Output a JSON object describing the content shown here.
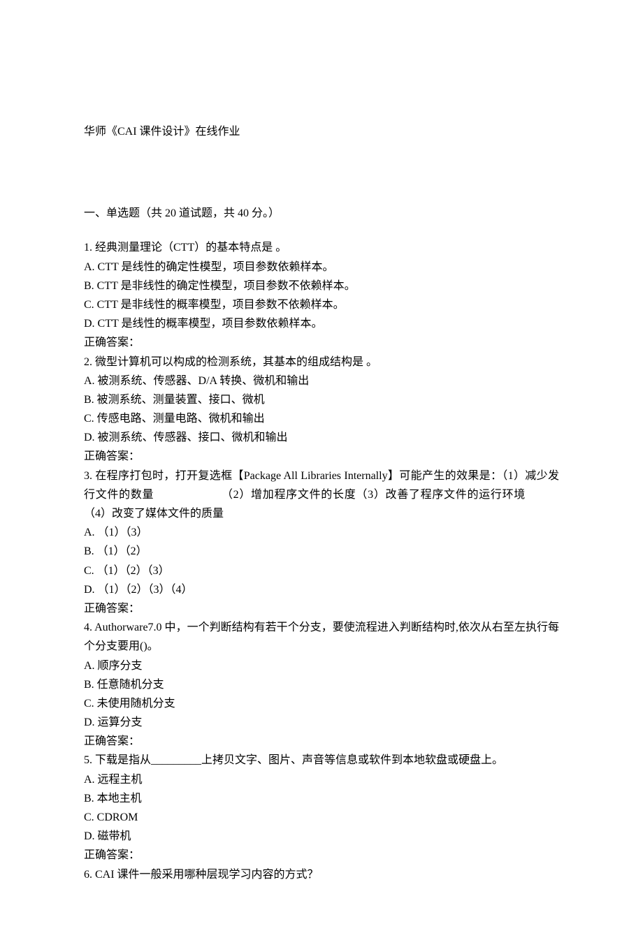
{
  "title": "华师《CAI 课件设计》在线作业",
  "section": {
    "heading": "一、单选题（共 20 道试题，共 40 分。）"
  },
  "questions": [
    {
      "stem": "1.   经典测量理论（CTT）的基本特点是 。",
      "options": [
        "A. CTT 是线性的确定性模型，项目参数依赖样本。",
        "B. CTT 是非线性的确定性模型，项目参数不依赖样本。",
        "C. CTT 是非线性的概率模型，项目参数不依赖样本。",
        "D. CTT 是线性的概率模型，项目参数依赖样本。"
      ],
      "answer": "正确答案："
    },
    {
      "stem": "2.   微型计算机可以构成的检测系统，其基本的组成结构是 。",
      "options": [
        "A. 被测系统、传感器、D/A 转换、微机和输出",
        "B. 被测系统、测量装置、接口、微机",
        "C. 传感电路、测量电路、微机和输出",
        "D. 被测系统、传感器、接口、微机和输出"
      ],
      "answer": "正确答案："
    },
    {
      "stem": "3.   在程序打包时，打开复选框【Package All Libraries Internally】可能产生的效果是：（1）减少发行文件的数量      （2）增加程序文件的长度（3）改善了程序文件的运行环境   （4）改变了媒体文件的质量",
      "options": [
        "A. （1）（3）",
        "B. （1）（2）",
        "C. （1）（2）（3）",
        "D. （1）（2）（3）（4）"
      ],
      "answer": "正确答案："
    },
    {
      "stem": "4.   Authorware7.0 中，一个判断结构有若干个分支，要使流程进入判断结构时,依次从右至左执行每个分支要用()。",
      "options": [
        "A. 顺序分支",
        "B. 任意随机分支",
        "C. 未使用随机分支",
        "D. 运算分支"
      ],
      "answer": "正确答案："
    },
    {
      "stem": "5.   下载是指从_________上拷贝文字、图片、声音等信息或软件到本地软盘或硬盘上。",
      "options": [
        "A. 远程主机",
        "B. 本地主机",
        "C. CDROM",
        "D. 磁带机"
      ],
      "answer": "正确答案："
    },
    {
      "stem": "6.   CAI 课件一般采用哪种层现学习内容的方式？",
      "options": [],
      "answer": null
    }
  ]
}
